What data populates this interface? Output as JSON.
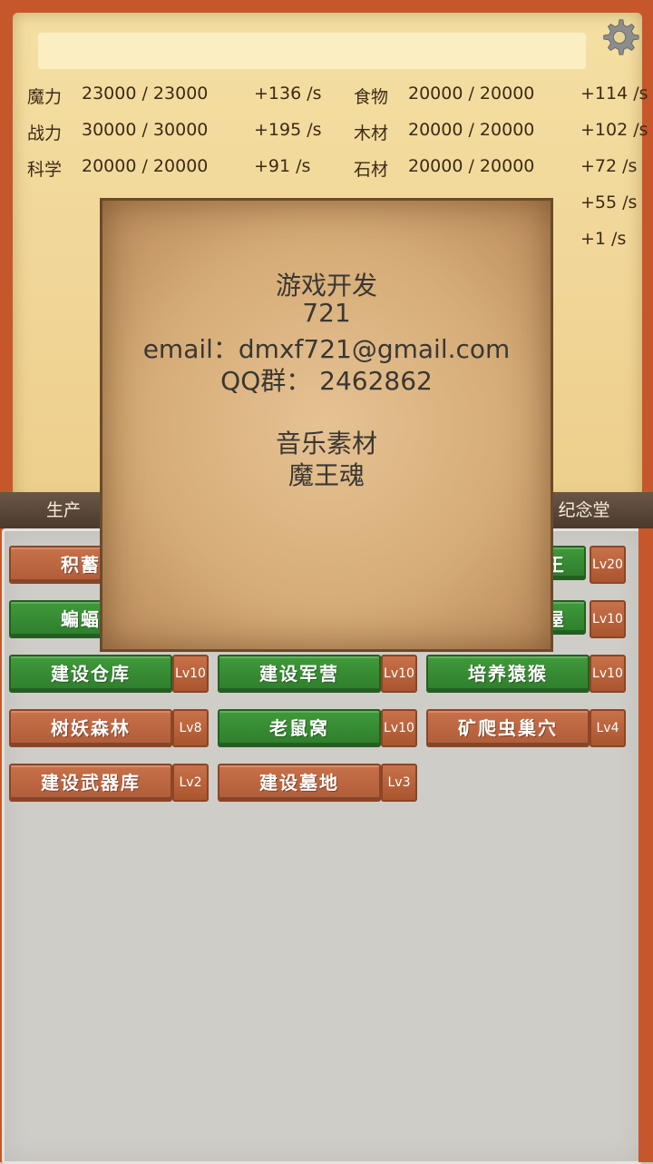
{
  "resources": {
    "left": [
      {
        "name": "魔力",
        "value": "23000 / 23000",
        "rate": "+136 /s"
      },
      {
        "name": "战力",
        "value": "30000 / 30000",
        "rate": "+195 /s"
      },
      {
        "name": "科学",
        "value": "20000 / 20000",
        "rate": "+91 /s"
      }
    ],
    "right": [
      {
        "name": "食物",
        "value": "20000 / 20000",
        "rate": "+114 /s"
      },
      {
        "name": "木材",
        "value": "20000 / 20000",
        "rate": "+102 /s"
      },
      {
        "name": "石材",
        "value": "20000 / 20000",
        "rate": "+72 /s"
      },
      {
        "name": "",
        "value": "",
        "rate": "+55 /s"
      },
      {
        "name": "",
        "value": "",
        "rate": "+1 /s"
      }
    ]
  },
  "tabs": {
    "production": "生产",
    "memorial": "纪念堂"
  },
  "buildings": [
    {
      "label": "积蓄力",
      "level": "",
      "color": "brown"
    },
    {
      "label": "",
      "level": "Lv20",
      "color": "green",
      "partial": "王"
    },
    {
      "label": "蝙蝠洞",
      "level": "",
      "color": "green"
    },
    {
      "label": "",
      "level": "Lv10",
      "color": "green",
      "partial": "屋"
    },
    {
      "label": "建设仓库",
      "level": "Lv10",
      "color": "green"
    },
    {
      "label": "建设军营",
      "level": "Lv10",
      "color": "green"
    },
    {
      "label": "培养猿猴",
      "level": "Lv10",
      "color": "green"
    },
    {
      "label": "树妖森林",
      "level": "Lv8",
      "color": "brown"
    },
    {
      "label": "老鼠窝",
      "level": "Lv10",
      "color": "green"
    },
    {
      "label": "矿爬虫巢穴",
      "level": "Lv4",
      "color": "brown"
    },
    {
      "label": "建设武器库",
      "level": "Lv2",
      "color": "brown"
    },
    {
      "label": "建设墓地",
      "level": "Lv3",
      "color": "brown"
    }
  ],
  "visible_partials": {
    "b1": "积蓄力",
    "b3": "蝙蝠洞",
    "b2": "王",
    "b4": "屋"
  },
  "dialog": {
    "line1": "游戏开发",
    "line2": "721",
    "line3": "email：dmxf721@gmail.com",
    "line4": "QQ群： 2462862",
    "line5": "音乐素材",
    "line6": "魔王魂"
  },
  "icons": {
    "settings": "gear-icon"
  }
}
